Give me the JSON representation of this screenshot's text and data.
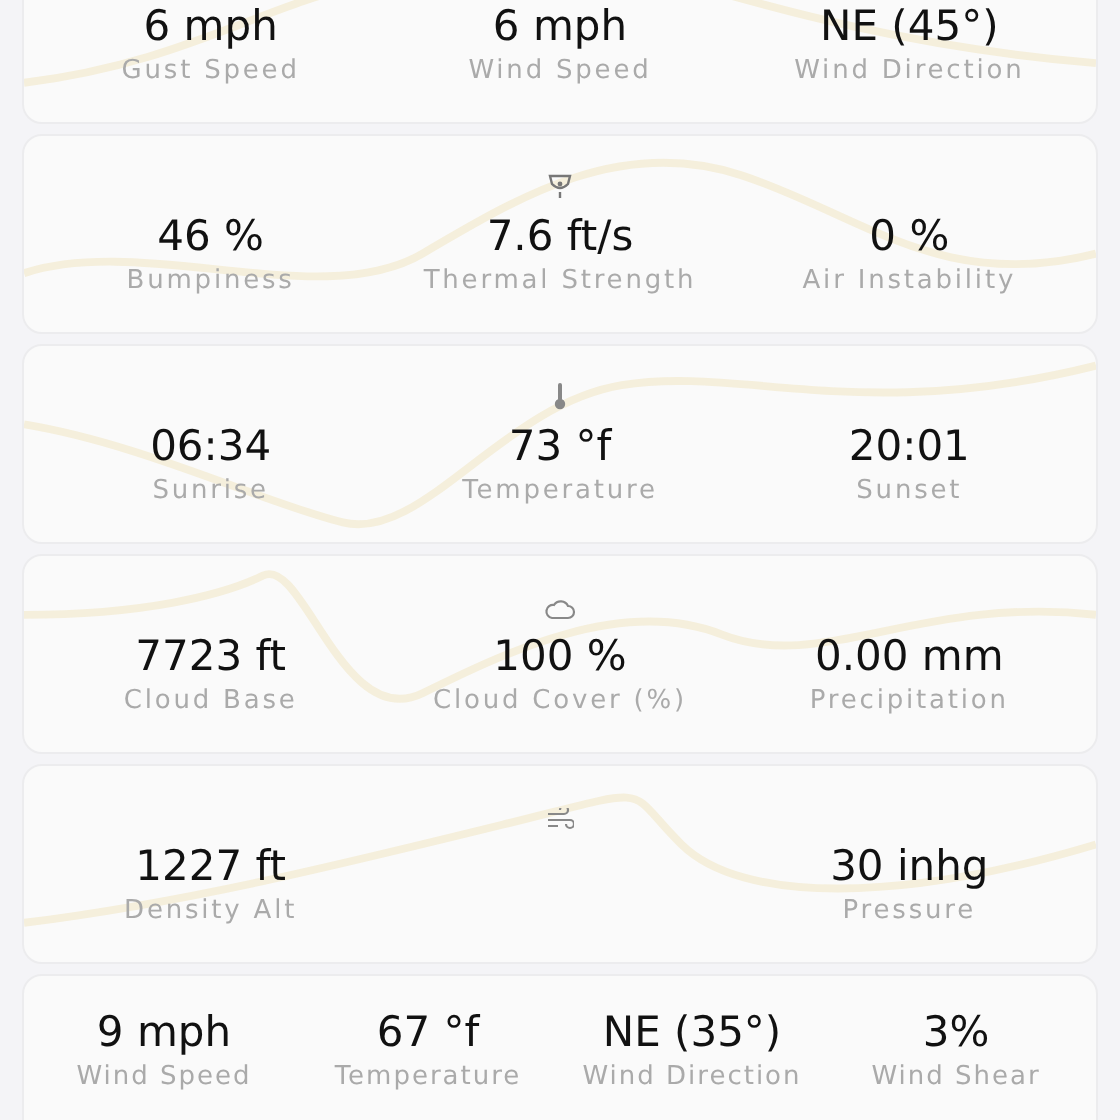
{
  "cards": [
    {
      "kind": "summary",
      "metrics": [
        {
          "value": "6 mph",
          "label": "Gust Speed"
        },
        {
          "value": "6 mph",
          "label": "Wind Speed"
        },
        {
          "value": "NE (45°)",
          "label": "Wind Direction"
        }
      ]
    },
    {
      "kind": "summary",
      "metrics": [
        {
          "value": "46 %",
          "label": "Bumpiness"
        },
        {
          "value": "7.6 ft/s",
          "label": "Thermal Strength"
        },
        {
          "value": "0 %",
          "label": "Air Instability"
        }
      ]
    },
    {
      "kind": "summary",
      "metrics": [
        {
          "value": "06:34",
          "label": "Sunrise"
        },
        {
          "value": "73 °f",
          "label": "Temperature"
        },
        {
          "value": "20:01",
          "label": "Sunset"
        }
      ]
    },
    {
      "kind": "summary",
      "metrics": [
        {
          "value": "7723 ft",
          "label": "Cloud Base"
        },
        {
          "value": "100 %",
          "label": "Cloud Cover (%)"
        },
        {
          "value": "0.00 mm",
          "label": "Precipitation"
        }
      ]
    },
    {
      "kind": "summary",
      "metrics": [
        {
          "value": "1227 ft",
          "label": "Density Alt"
        },
        {
          "value": "30 inhg",
          "label": "Pressure"
        }
      ]
    },
    {
      "kind": "grid",
      "metrics": [
        {
          "value": "9 mph",
          "label": "Wind Speed"
        },
        {
          "value": "67 °f",
          "label": "Temperature"
        },
        {
          "value": "NE (35°)",
          "label": "Wind Direction"
        },
        {
          "value": "3%",
          "label": "Wind Shear"
        }
      ]
    }
  ]
}
